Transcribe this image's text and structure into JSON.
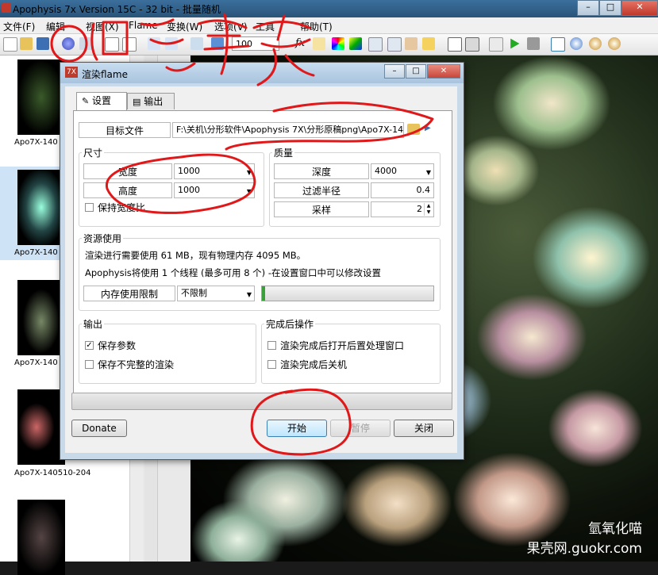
{
  "window": {
    "title": "Apophysis 7x Version 15C  - 32 bit - 批量随机"
  },
  "menu": [
    "文件(F)",
    "编辑",
    "视图(X)",
    "Flame",
    "变换(W)",
    "选项(V)",
    "工具",
    "帮助(T)"
  ],
  "toolbar": {
    "zoom_value": "100",
    "fx_label": "fx"
  },
  "thumbnails": [
    {
      "label": "Apo7X-140"
    },
    {
      "label": "Apo7X-140"
    },
    {
      "label": "Apo7X-140"
    },
    {
      "label": "Apo7X-140510-204"
    }
  ],
  "dialog": {
    "icon_text": "7X",
    "title": "渲染flame",
    "tabs": {
      "settings": "设置",
      "output": "输出"
    },
    "target_file_label": "目标文件",
    "target_file_value": "F:\\关机\\分形软件\\Apophysis 7X\\分形原稿png\\Apo7X-14",
    "size": {
      "title": "尺寸",
      "width_label": "宽度",
      "width_value": "1000",
      "height_label": "高度",
      "height_value": "1000",
      "keep_ratio_label": "保持宽度比"
    },
    "quality": {
      "title": "质量",
      "depth_label": "深度",
      "depth_value": "4000",
      "filter_label": "过滤半径",
      "filter_value": "0.4",
      "samples_label": "采样",
      "samples_value": "2"
    },
    "resources": {
      "title": "资源使用",
      "line1": "渲染进行需要使用 61 MB，现有物理内存 4095 MB。",
      "line2": "Apophysis将使用 1 个线程 (最多可用 8 个) -在设置窗口中可以修改设置",
      "mem_limit_label": "内存使用限制",
      "mem_limit_value": "不限制",
      "mem_usage_fraction": 0.01
    },
    "output_group": {
      "title": "输出",
      "save_params_label": "保存参数",
      "save_params_checked": true,
      "save_incomplete_label": "保存不完整的渲染",
      "save_incomplete_checked": false
    },
    "after_group": {
      "title": "完成后操作",
      "open_post_label": "渲染完成后打开后置处理窗口",
      "shutdown_label": "渲染完成后关机"
    },
    "buttons": {
      "donate": "Donate",
      "start": "开始",
      "pause": "暂停",
      "close": "关闭"
    }
  },
  "watermark": {
    "line1": "氫氧化喵",
    "line2": "果壳网.guokr.com"
  },
  "colors": {
    "annotation_red": "#e0181a",
    "progress_green": "#3aa03a"
  }
}
